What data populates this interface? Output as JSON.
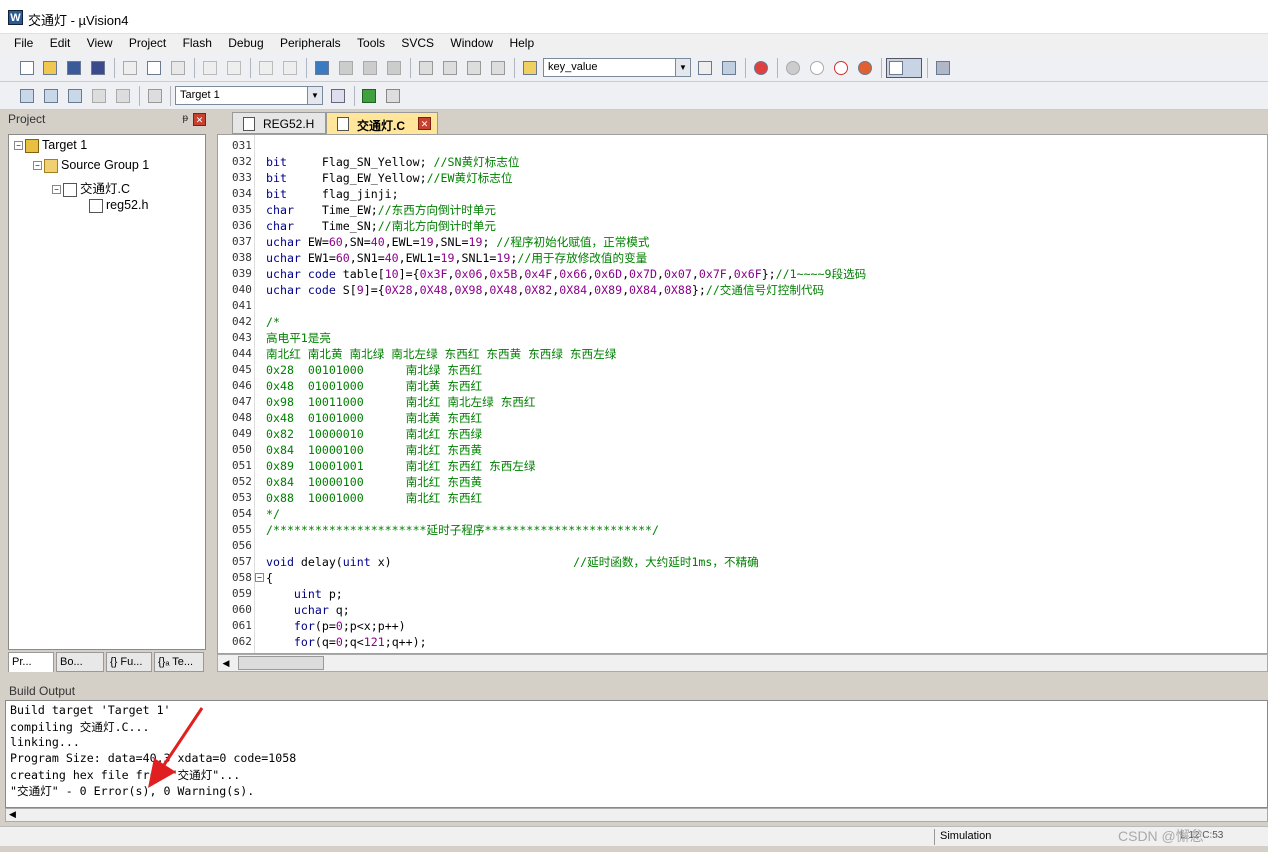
{
  "window": {
    "title": "交通灯  - µVision4",
    "app_icon": "W"
  },
  "menu": [
    "File",
    "Edit",
    "View",
    "Project",
    "Flash",
    "Debug",
    "Peripherals",
    "Tools",
    "SVCS",
    "Window",
    "Help"
  ],
  "toolbar": {
    "find_combo": "key_value",
    "target_combo": "Target 1"
  },
  "project": {
    "header": "Project",
    "pin": "ᵽ",
    "tree": [
      {
        "label": "Target 1",
        "icon": "target-icon"
      },
      {
        "label": "Source Group 1",
        "icon": "folder-icon"
      },
      {
        "label": "交通灯.C",
        "icon": "file-icon"
      },
      {
        "label": "reg52.h",
        "icon": "file-icon"
      }
    ],
    "tabs": [
      "Pr...",
      "Bo...",
      "{} Fu...",
      "{}ₐ Te..."
    ]
  },
  "editor": {
    "tabs": [
      {
        "label": "REG52.H",
        "active": false
      },
      {
        "label": "交通灯.C",
        "active": true
      }
    ],
    "lines": [
      {
        "n": "031",
        "t": "",
        "c": ""
      },
      {
        "n": "032",
        "t": "bit     Flag_SN_Yellow; ",
        "c": "//SN黄灯标志位"
      },
      {
        "n": "033",
        "t": "bit     Flag_EW_Yellow;",
        "c": "//EW黄灯标志位"
      },
      {
        "n": "034",
        "t": "bit     flag_jinji;",
        "c": ""
      },
      {
        "n": "035",
        "t": "char    Time_EW;",
        "c": "//东西方向倒计时单元"
      },
      {
        "n": "036",
        "t": "char    Time_SN;",
        "c": "//南北方向倒计时单元"
      },
      {
        "n": "037",
        "t": "uchar EW=60,SN=40,EWL=19,SNL=19; ",
        "c": "//程序初始化赋值，正常模式"
      },
      {
        "n": "038",
        "t": "uchar EW1=60,SN1=40,EWL1=19,SNL1=19;",
        "c": "//用于存放修改值的变量"
      },
      {
        "n": "039",
        "t": "uchar code table[10]={0x3F,0x06,0x5B,0x4F,0x66,0x6D,0x7D,0x07,0x7F,0x6F};",
        "c": "//1~~~~9段选码"
      },
      {
        "n": "040",
        "t": "uchar code S[9]={0X28,0X48,0X98,0X48,0X82,0X84,0X89,0X84,0X88};",
        "c": "//交通信号灯控制代码"
      },
      {
        "n": "041",
        "t": "",
        "c": ""
      },
      {
        "n": "042",
        "t": "",
        "c": "/*"
      },
      {
        "n": "043",
        "t": "",
        "c": "高电平1是亮"
      },
      {
        "n": "044",
        "t": "",
        "c": "南北红 南北黄 南北绿 南北左绿 东西红 东西黄 东西绿 东西左绿"
      },
      {
        "n": "045",
        "t": "",
        "c": "0x28  00101000      南北绿 东西红"
      },
      {
        "n": "046",
        "t": "",
        "c": "0x48  01001000      南北黄 东西红"
      },
      {
        "n": "047",
        "t": "",
        "c": "0x98  10011000      南北红 南北左绿 东西红"
      },
      {
        "n": "048",
        "t": "",
        "c": "0x48  01001000      南北黄 东西红"
      },
      {
        "n": "049",
        "t": "",
        "c": "0x82  10000010      南北红 东西绿"
      },
      {
        "n": "050",
        "t": "",
        "c": "0x84  10000100      南北红 东西黄"
      },
      {
        "n": "051",
        "t": "",
        "c": "0x89  10001001      南北红 东西红 东西左绿"
      },
      {
        "n": "052",
        "t": "",
        "c": "0x84  10000100      南北红 东西黄"
      },
      {
        "n": "053",
        "t": "",
        "c": "0x88  10001000      南北红 东西红"
      },
      {
        "n": "054",
        "t": "",
        "c": "*/"
      },
      {
        "n": "055",
        "t": "",
        "c": "/**********************延时子程序************************/"
      },
      {
        "n": "056",
        "t": "",
        "c": ""
      },
      {
        "n": "057",
        "t": "void delay(uint x)                          ",
        "c": "//延时函数，大约延时1ms，不精确"
      },
      {
        "n": "058",
        "t": "{",
        "c": ""
      },
      {
        "n": "059",
        "t": "    uint p;",
        "c": ""
      },
      {
        "n": "060",
        "t": "    uchar q;",
        "c": ""
      },
      {
        "n": "061",
        "t": "    for(p=0;p<x;p++)",
        "c": ""
      },
      {
        "n": "062",
        "t": "    for(q=0;q<121;q++);",
        "c": ""
      }
    ]
  },
  "build": {
    "header": "Build Output",
    "lines": [
      "Build target 'Target 1'",
      "compiling 交通灯.C...",
      "linking...",
      "Program Size: data=40.3 xdata=0 code=1058",
      "creating hex file from \"交通灯\"...",
      "\"交通灯\" - 0 Error(s), 0 Warning(s)."
    ]
  },
  "status": {
    "mode": "Simulation",
    "position": "L:12 C:53"
  },
  "watermark": "CSDN @懈怠···",
  "colors": {
    "keyword": "#00008b",
    "comment": "#008000",
    "active_tab": "#ffe69a",
    "arrow": "#e02020"
  }
}
